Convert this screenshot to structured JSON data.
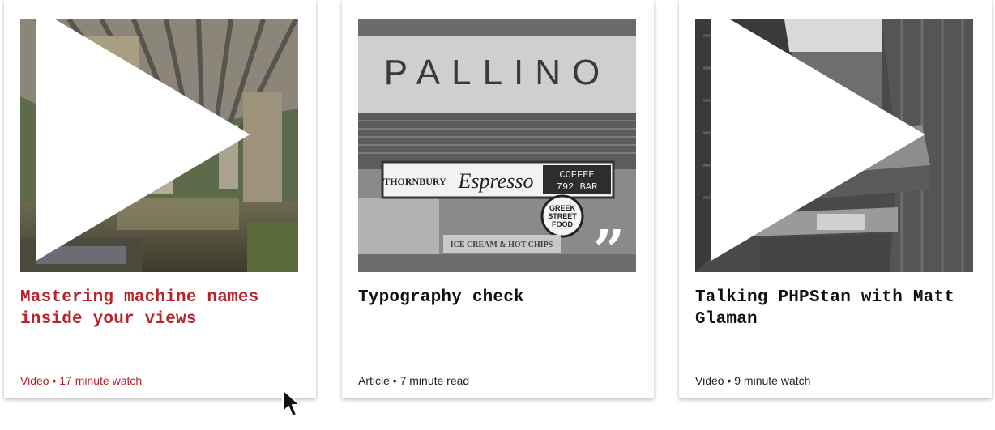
{
  "cards": [
    {
      "title": "Mastering machine names inside your views",
      "type": "Video",
      "separator": "•",
      "duration": "17 minute watch",
      "media_icon": "play-icon",
      "accent_color": "#b8232a",
      "state": "hover"
    },
    {
      "title": "Typography check",
      "type": "Article",
      "separator": "•",
      "duration": "7 minute read",
      "media_icon": "quote-icon",
      "image_signs": {
        "marquee": "PALLINO",
        "sign_left": "THORNBURY",
        "sign_script": "Espresso",
        "sign_right_top": "COFFEE",
        "sign_right_bottom": "792 BAR",
        "round_sign_top": "GREEK",
        "round_sign_mid": "STREET",
        "round_sign_bottom": "FOOD",
        "lower_sign": "ICE CREAM & HOT CHIPS"
      }
    },
    {
      "title": "Talking PHPStan with Matt Glaman",
      "type": "Video",
      "separator": "•",
      "duration": "9 minute watch",
      "media_icon": "play-icon"
    }
  ],
  "quote_glyph": "”"
}
